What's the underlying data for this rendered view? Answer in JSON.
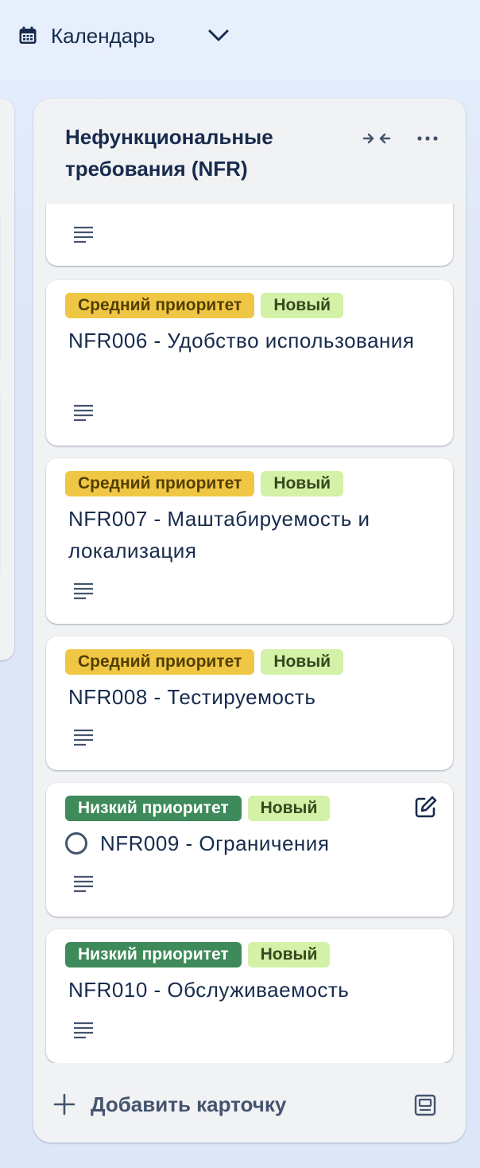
{
  "header": {
    "view_label": "Календарь"
  },
  "list": {
    "title": "Нефункциональные требования (NFR)",
    "add_card_label": "Добавить карточку"
  },
  "cards": [
    {
      "labels": [],
      "title": "",
      "has_description": true
    },
    {
      "labels": [
        {
          "text": "Средний приоритет",
          "color": "#f0c744"
        },
        {
          "text": "Новый",
          "color": "#d3f1a7"
        }
      ],
      "title": "NFR006 - Удобство использования",
      "has_description": true
    },
    {
      "labels": [
        {
          "text": "Средний приоритет",
          "color": "#f0c744"
        },
        {
          "text": "Новый",
          "color": "#d3f1a7"
        }
      ],
      "title": "NFR007 - Маштабируемость и локализация",
      "has_description": true
    },
    {
      "labels": [
        {
          "text": "Средний приоритет",
          "color": "#f0c744"
        },
        {
          "text": "Новый",
          "color": "#d3f1a7"
        }
      ],
      "title": "NFR008 - Тестируемость",
      "has_description": true
    },
    {
      "labels": [
        {
          "text": "Низкий приоритет",
          "color": "#3f8a5a"
        },
        {
          "text": "Новый",
          "color": "#d3f1a7"
        }
      ],
      "title": "NFR009 - Ограничения",
      "has_description": true,
      "hovered": true
    },
    {
      "labels": [
        {
          "text": "Низкий приоритет",
          "color": "#3f8a5a"
        },
        {
          "text": "Новый",
          "color": "#d3f1a7"
        }
      ],
      "title": "NFR010 - Обслуживаемость",
      "has_description": true
    }
  ],
  "icons": {
    "view": "calendar-icon",
    "view_dropdown": "chevron-down-icon",
    "collapse": "collapse-list-icon",
    "menu": "more-horizontal-icon",
    "description": "description-lines-icon",
    "complete": "complete-circle-icon",
    "edit": "edit-icon",
    "add": "plus-icon",
    "template": "card-template-icon"
  }
}
